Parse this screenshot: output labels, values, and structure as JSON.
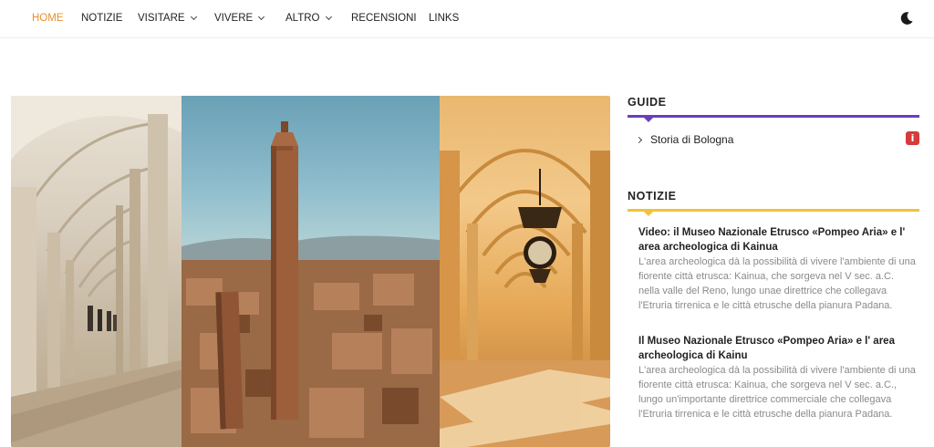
{
  "nav": {
    "items": [
      {
        "label": "HOME",
        "active": true,
        "dropdown": false
      },
      {
        "label": "NOTIZIE",
        "active": false,
        "dropdown": false
      },
      {
        "label": "VISITARE",
        "active": false,
        "dropdown": true
      },
      {
        "label": "VIVERE",
        "active": false,
        "dropdown": true
      },
      {
        "label": "ALTRO",
        "active": false,
        "dropdown": true
      },
      {
        "label": "RECENSIONI",
        "active": false,
        "dropdown": false
      },
      {
        "label": "LINKS",
        "active": false,
        "dropdown": false
      }
    ],
    "dark_mode_icon": "moon-icon",
    "active_color": "#e8912d"
  },
  "hero": {
    "panels": [
      "portico-left",
      "towers-cityscape",
      "portico-clock"
    ]
  },
  "sidebar": {
    "guide": {
      "title": "GUIDE",
      "accent": "#6a3fbf",
      "items": [
        {
          "label": "Storia di Bologna",
          "badge_icon": "info-icon",
          "badge_color": "#d63a3a"
        }
      ]
    },
    "notizie": {
      "title": "NOTIZIE",
      "accent": "#f0c43a",
      "posts": [
        {
          "title": "Video: il Museo Nazionale Etrusco «Pompeo Aria» e l' area archeologica di Kainua",
          "excerpt": "L'area archeologica dà la possibilità di vivere l'ambiente di una fiorente città etrusca: Kainua, che sorgeva nel V sec. a.C. nella valle del Reno, lungo unae direttrice che collegava l'Etruria tirrenica e le città etrusche della pianura Padana."
        },
        {
          "title": "Il Museo Nazionale Etrusco «Pompeo Aria» e l' area archeologica di Kainu",
          "excerpt": "L'area archeologica dà la possibilità di vivere l'ambiente di una fiorente città etrusca: Kainua, che sorgeva nel V sec. a.C., lungo un'importante direttrice commerciale che collegava l'Etruria tirrenica e le città etrusche della pianura Padana."
        }
      ]
    }
  }
}
